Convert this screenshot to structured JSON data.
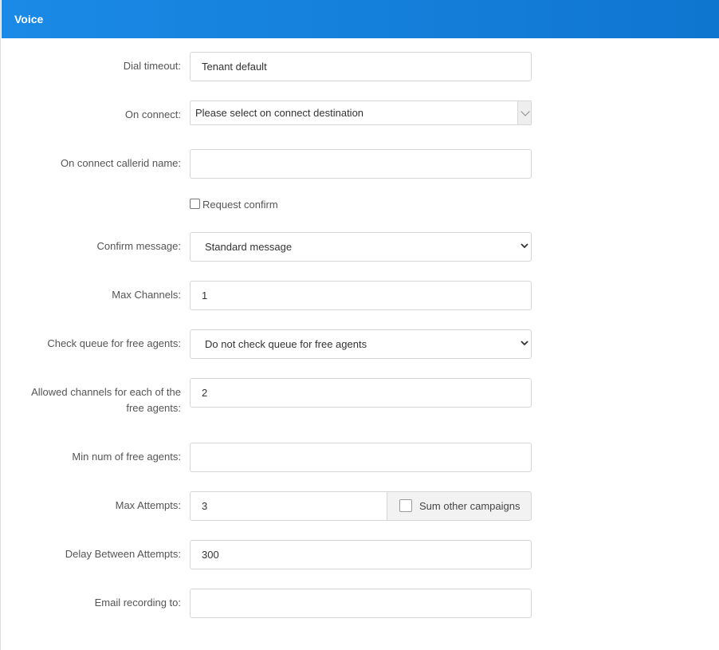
{
  "panel": {
    "title": "Voice"
  },
  "form": {
    "dial_timeout": {
      "label": "Dial timeout:",
      "value": "Tenant default"
    },
    "on_connect": {
      "label": "On connect:",
      "placeholder": "Please select on connect destination"
    },
    "on_connect_callerid_name": {
      "label": "On connect callerid name:",
      "value": ""
    },
    "request_confirm": {
      "label": "Request confirm",
      "checked": false
    },
    "confirm_message": {
      "label": "Confirm message:",
      "value": "Standard message"
    },
    "max_channels": {
      "label": "Max Channels:",
      "value": "1"
    },
    "check_queue": {
      "label": "Check queue for free agents:",
      "value": "Do not check queue for free agents"
    },
    "allowed_channels": {
      "label_line1": "Allowed channels for each of the",
      "label_line2": "free agents:",
      "value": "2"
    },
    "min_free_agents": {
      "label": "Min num of free agents:",
      "value": ""
    },
    "max_attempts": {
      "label": "Max Attempts:",
      "value": "3",
      "sum_other_campaigns_label": "Sum other campaigns",
      "sum_other_campaigns_checked": false
    },
    "delay_between_attempts": {
      "label": "Delay Between Attempts:",
      "value": "300"
    },
    "email_recording": {
      "label": "Email recording to:",
      "value": ""
    }
  },
  "icons": {
    "select_arrow": "chevron-down-icon"
  },
  "colors": {
    "header_start": "#1a8ae6",
    "header_end": "#0f76d0"
  }
}
